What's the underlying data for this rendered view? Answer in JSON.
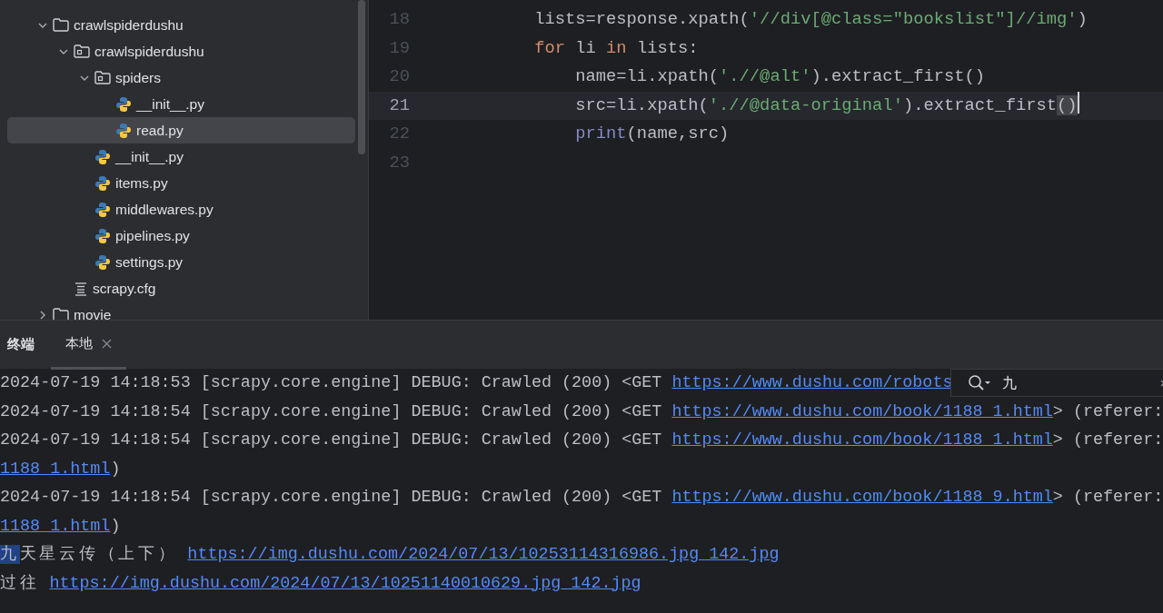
{
  "project_tree": [
    {
      "label": "crawlspiderdushu",
      "kind": "folder",
      "expanded": true,
      "selected": false,
      "children": [
        {
          "label": "crawlspiderdushu",
          "kind": "package",
          "expanded": true,
          "selected": false,
          "children": [
            {
              "label": "spiders",
              "kind": "package",
              "expanded": true,
              "selected": false,
              "children": [
                {
                  "label": "__init__.py",
                  "kind": "python",
                  "selected": false
                },
                {
                  "label": "read.py",
                  "kind": "python",
                  "selected": true
                }
              ]
            },
            {
              "label": "__init__.py",
              "kind": "python",
              "selected": false
            },
            {
              "label": "items.py",
              "kind": "python",
              "selected": false
            },
            {
              "label": "middlewares.py",
              "kind": "python",
              "selected": false
            },
            {
              "label": "pipelines.py",
              "kind": "python",
              "selected": false
            },
            {
              "label": "settings.py",
              "kind": "python",
              "selected": false
            }
          ]
        },
        {
          "label": "scrapy.cfg",
          "kind": "config",
          "selected": false
        }
      ]
    },
    {
      "label": "movie",
      "kind": "folder",
      "expanded": false,
      "selected": false
    }
  ],
  "editor": {
    "lines": [
      {
        "number": "18",
        "current": false,
        "tokens": [
          {
            "kind": "plain",
            "text": "lists=response.xpath("
          },
          {
            "kind": "string",
            "text": "'//div[@class=\"bookslist\"]//img'"
          },
          {
            "kind": "plain",
            "text": ")"
          }
        ]
      },
      {
        "number": "19",
        "current": false,
        "tokens": [
          {
            "kind": "keyword",
            "text": "for"
          },
          {
            "kind": "plain",
            "text": " li "
          },
          {
            "kind": "keyword",
            "text": "in"
          },
          {
            "kind": "plain",
            "text": " lists:"
          }
        ],
        "children": [
          {
            "number": "20",
            "current": false,
            "tokens": [
              {
                "kind": "plain",
                "text": "name=li.xpath("
              },
              {
                "kind": "string",
                "text": "'.//@alt'"
              },
              {
                "kind": "plain",
                "text": ").extract_first()"
              }
            ]
          },
          {
            "number": "21",
            "current": true,
            "tokens": [
              {
                "kind": "plain",
                "text": "src=li.xpath("
              },
              {
                "kind": "string",
                "text": "'.//@data-original'"
              },
              {
                "kind": "plain",
                "text": ").extract_first"
              },
              {
                "kind": "matched",
                "text": "()"
              }
            ]
          },
          {
            "number": "22",
            "current": false,
            "tokens": [
              {
                "kind": "builtin",
                "text": "print"
              },
              {
                "kind": "plain",
                "text": "(name,src)"
              }
            ]
          }
        ]
      },
      {
        "number": "23",
        "current": false
      }
    ]
  },
  "terminal": {
    "title": "终端",
    "tabs": [
      {
        "label": "本地",
        "selected": true
      }
    ],
    "search": {
      "value": "九"
    },
    "lines": [
      [
        {
          "kind": "plain",
          "text": "2024-07-19 14:18:53 [scrapy.core.engine] DEBUG: Crawled (200) <GET "
        },
        {
          "kind": "link",
          "text": "https://www.dushu.com/robots"
        }
      ],
      [
        {
          "kind": "plain",
          "text": "2024-07-19 14:18:54 [scrapy.core.engine] DEBUG: Crawled (200) <GET "
        },
        {
          "kind": "link",
          "text": "https://www.dushu.com/book/1188_1.html"
        },
        {
          "kind": "plain",
          "text": "> (referer:"
        }
      ],
      [
        {
          "kind": "plain",
          "text": "2024-07-19 14:18:54 [scrapy.core.engine] DEBUG: Crawled (200) <GET "
        },
        {
          "kind": "link",
          "text": "https://www.dushu.com/book/1188_1.html"
        },
        {
          "kind": "plain",
          "text": "> (referer:"
        }
      ],
      [
        {
          "kind": "link",
          "text": "1188_1.html"
        },
        {
          "kind": "plain",
          "text": ")"
        }
      ],
      [
        {
          "kind": "plain",
          "text": "2024-07-19 14:18:54 [scrapy.core.engine] DEBUG: Crawled (200) <GET "
        },
        {
          "kind": "link",
          "text": "https://www.dushu.com/book/1188_9.html"
        },
        {
          "kind": "plain",
          "text": "> (referer:"
        }
      ],
      [
        {
          "kind": "link",
          "text": "1188_1.html"
        },
        {
          "kind": "plain",
          "text": ")"
        }
      ],
      [
        {
          "kind": "match",
          "text": "九"
        },
        {
          "kind": "wide",
          "text": "天星云传（上下）"
        },
        {
          "kind": "link",
          "text": "https://img.dushu.com/2024/07/13/10253114316986.jpg_142.jpg"
        }
      ],
      [
        {
          "kind": "wide",
          "text": "过往"
        },
        {
          "kind": "link",
          "text": "https://img.dushu.com/2024/07/13/10251140010629.jpg_142.jpg"
        }
      ]
    ]
  }
}
